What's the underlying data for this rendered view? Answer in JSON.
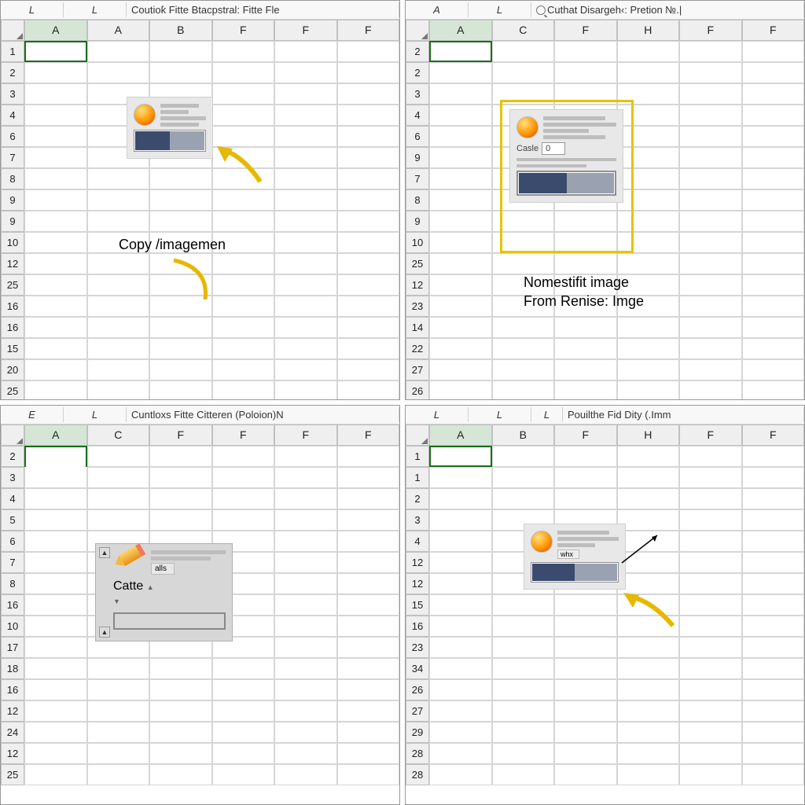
{
  "panels": [
    {
      "toolbar": {
        "c1": "L",
        "c2": "L",
        "wide": "Coutioƙ Fitte Btacpstral: Fitte Fle"
      },
      "cols": [
        "A",
        "A",
        "B",
        "F",
        "F",
        "F"
      ],
      "rows": [
        "1",
        "2",
        "3",
        "4",
        "6",
        "7",
        "8",
        "9",
        "9",
        "10",
        "12",
        "25",
        "16",
        "16",
        "15",
        "20",
        "25"
      ],
      "annotation": "Copy /imagemen",
      "activeCell": "A1"
    },
    {
      "toolbar": {
        "c1": "A",
        "c2": "L",
        "wide": "Cuthat Disargeh‹: Pretion №.|",
        "hasSearch": true
      },
      "cols": [
        "A",
        "C",
        "F",
        "H",
        "F",
        "F"
      ],
      "rows": [
        "2",
        "2",
        "3",
        "4",
        "6",
        "9",
        "7",
        "8",
        "9",
        "10",
        "25",
        "12",
        "23",
        "14",
        "22",
        "27",
        "26"
      ],
      "annotation1": "Nomestifit image",
      "annotation2": "From Renise: Imge",
      "thumbLabel": "Casle",
      "thumbValue": "0",
      "activeCell": "A2"
    },
    {
      "toolbar": {
        "c1": "E",
        "c2": "L",
        "wide": "Cuntloxs Fitte Citteren (Poloion)N"
      },
      "cols": [
        "A",
        "C",
        "F",
        "F",
        "F",
        "F"
      ],
      "rows": [
        "2",
        "3",
        "4",
        "5",
        "6",
        "7",
        "8",
        "16",
        "10",
        "17",
        "18",
        "16",
        "12",
        "24",
        "12",
        "25"
      ],
      "thumbText": "alls",
      "thumbLabel": "Catte",
      "activeCell": "A2-3"
    },
    {
      "toolbar": {
        "c1": "L",
        "c2": "L",
        "c3": "L",
        "wide": "Pouilthe Fid Dity (.Imm"
      },
      "cols": [
        "A",
        "B",
        "F",
        "H",
        "F",
        "F"
      ],
      "rows": [
        "1",
        "1",
        "2",
        "3",
        "4",
        "12",
        "12",
        "15",
        "16",
        "23",
        "34",
        "26",
        "27",
        "29",
        "28",
        "28"
      ],
      "thumbText": "whx",
      "activeCell": "A1"
    }
  ]
}
